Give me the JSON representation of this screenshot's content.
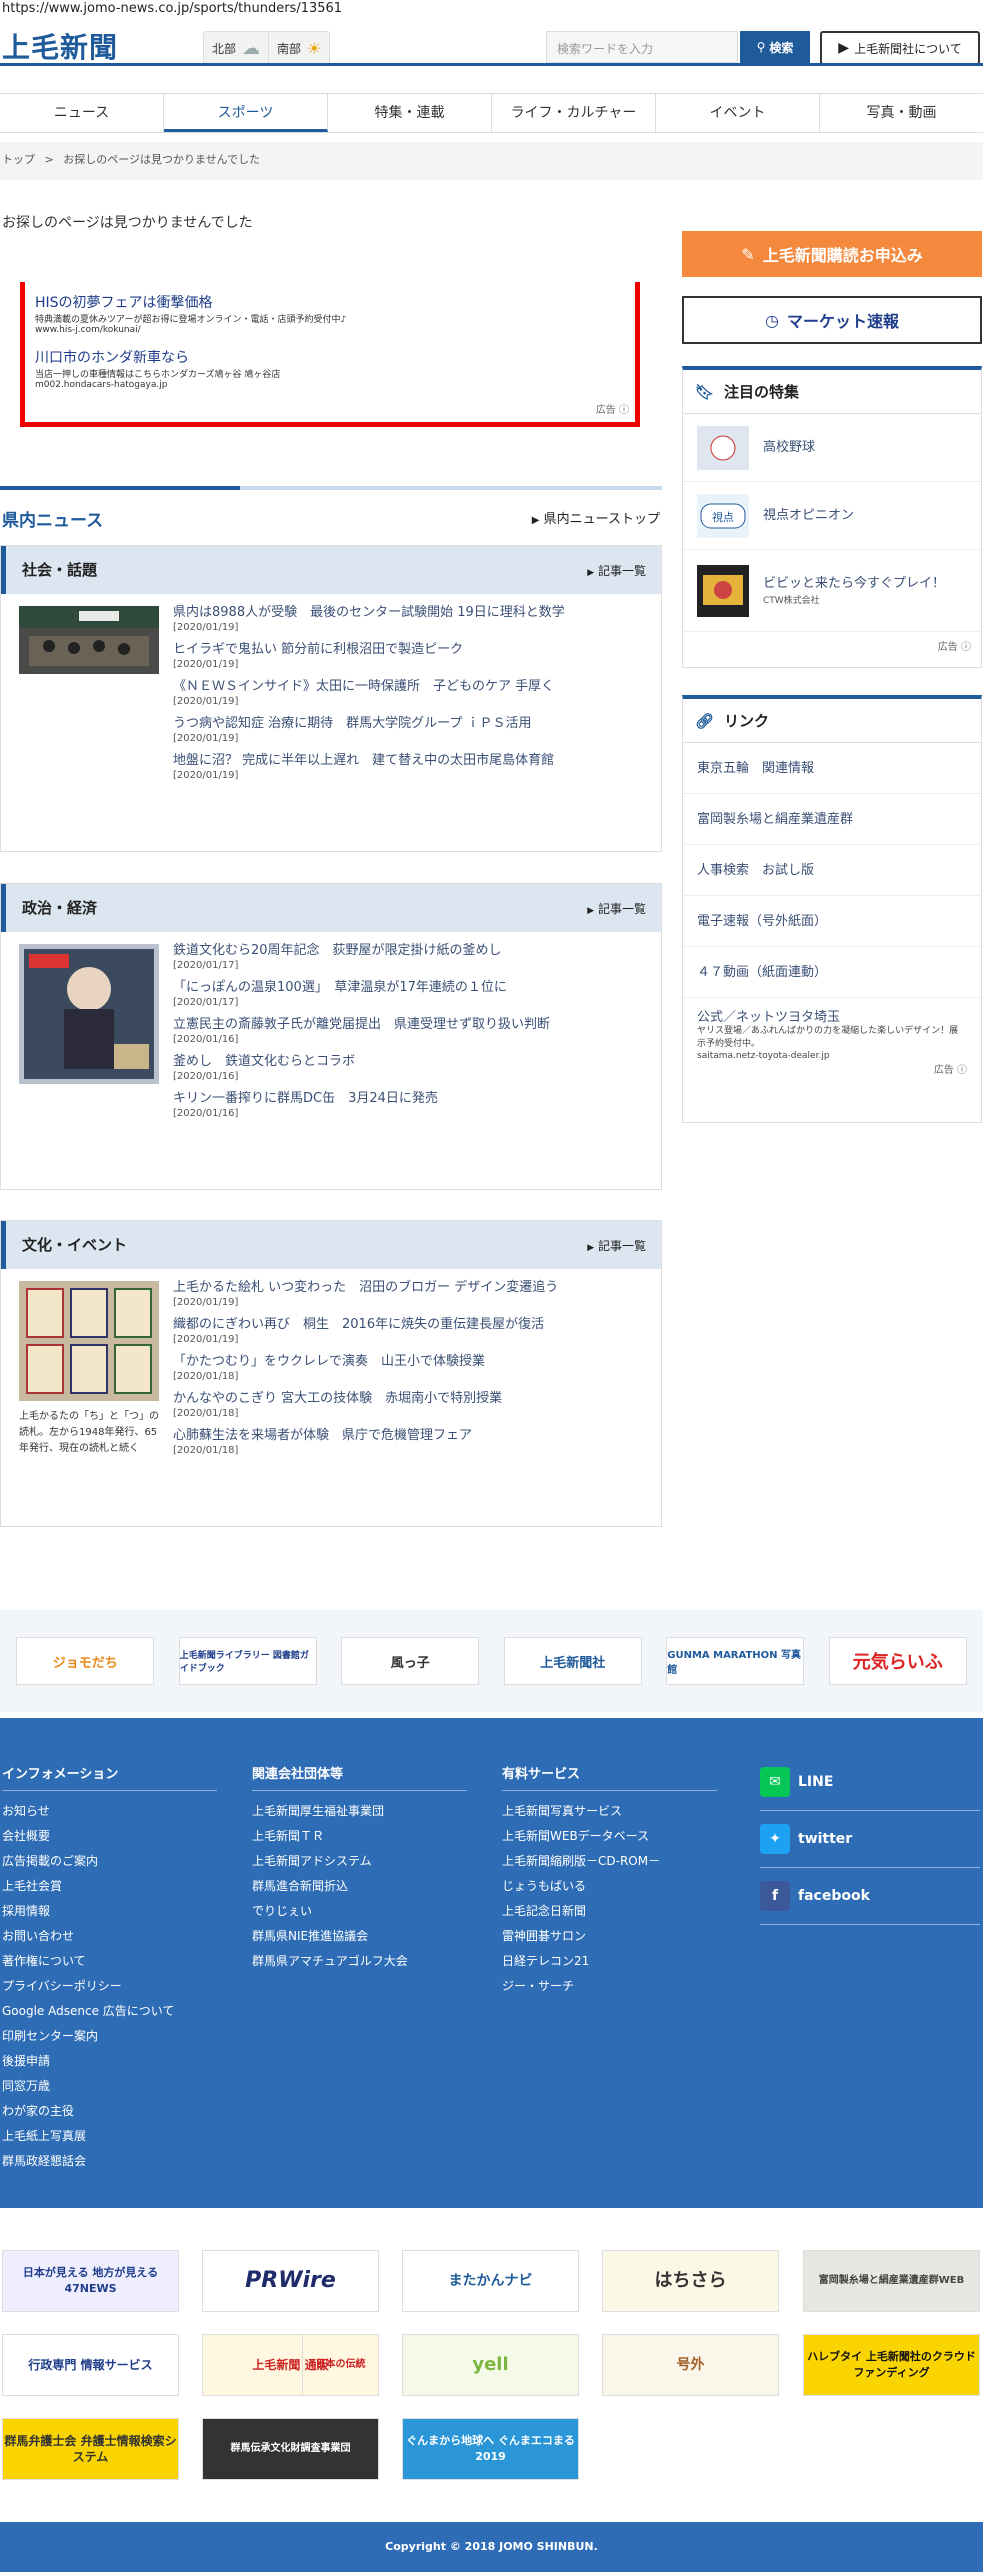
{
  "url": "https://www.jomo-news.co.jp/sports/thunders/13561",
  "header": {
    "logo": "上毛新聞",
    "weather": [
      {
        "label": "北部"
      },
      {
        "label": "南部"
      }
    ],
    "search_placeholder": "検索ワードを入力",
    "search_button": "検索",
    "about_button": "上毛新聞社について"
  },
  "nav": [
    "ニュース",
    "スポーツ",
    "特集・連載",
    "ライフ・カルチャー",
    "イベント",
    "写真・動画"
  ],
  "nav_active": "スポーツ",
  "breadcrumb": {
    "home": "トップ",
    "sep": ">",
    "current": "お探しのページは見つかりませんでした"
  },
  "not_found": "お探しのページは見つかりませんでした",
  "ad": {
    "items": [
      {
        "title": "HISの初夢フェアは衝撃価格",
        "desc": "特典満載の夏休みツアーが超お得に登場オンライン・電話・店頭予約受付中♪",
        "url": "www.his-j.com/kokunai/"
      },
      {
        "title": "川口市のホンダ新車なら",
        "desc": "当店一押しの車種情報はこちらホンダカーズ鳩ヶ谷 鳩ヶ谷店",
        "url": "m002.hondacars-hatogaya.jp"
      }
    ],
    "label": "広告"
  },
  "section": {
    "title": "県内ニュース",
    "link": "県内ニューストップ"
  },
  "boxes": [
    {
      "title": "社会・話題",
      "more": "記事一覧",
      "items": [
        {
          "h": "県内は8988人が受験　最後のセンター試験開始 19日に理科と数学",
          "d": "[2020/01/19]"
        },
        {
          "h": "ヒイラギで鬼払い 節分前に利根沼田で製造ピーク",
          "d": "[2020/01/19]"
        },
        {
          "h": "《ＮＥＷＳインサイド》太田に一時保護所　子どものケア 手厚く",
          "d": "[2020/01/19]"
        },
        {
          "h": "うつ病や認知症 治療に期待　群馬大学院グループ ｉＰＳ活用",
          "d": "[2020/01/19]"
        },
        {
          "h": "地盤に沼？ 完成に半年以上遅れ　建て替え中の太田市尾島体育館",
          "d": "[2020/01/19]"
        }
      ]
    },
    {
      "title": "政治・経済",
      "more": "記事一覧",
      "items": [
        {
          "h": "鉄道文化むら20周年記念　荻野屋が限定掛け紙の釜めし",
          "d": "[2020/01/17]"
        },
        {
          "h": "「にっぽんの温泉100選」　草津温泉が17年連続の１位に",
          "d": "[2020/01/17]"
        },
        {
          "h": "立憲民主の斎藤敦子氏が離党届提出　県連受理せず取り扱い判断",
          "d": "[2020/01/16]"
        },
        {
          "h": "釜めし　鉄道文化むらとコラボ",
          "d": "[2020/01/16]"
        },
        {
          "h": "キリン一番搾りに群馬DC缶　3月24日に発売",
          "d": "[2020/01/16]"
        }
      ]
    },
    {
      "title": "文化・イベント",
      "more": "記事一覧",
      "caption": "上毛かるたの「ち」と「つ」の読札。左から1948年発行、65年発行、現在の読札と続く",
      "items": [
        {
          "h": "上毛かるた絵札 いつ変わった　沼田のブロガー デザイン変遷追う",
          "d": "[2020/01/19]"
        },
        {
          "h": "織都のにぎわい再び　桐生　2016年に焼失の重伝建長屋が復活",
          "d": "[2020/01/19]"
        },
        {
          "h": "「かたつむり」をウクレレで演奏　山王小で体験授業",
          "d": "[2020/01/18]"
        },
        {
          "h": "かんなやのこぎり 宮大工の技体験　赤堀南小で特別授業",
          "d": "[2020/01/18]"
        },
        {
          "h": "心肺蘇生法を来場者が体験　県庁で危機管理フェア",
          "d": "[2020/01/18]"
        }
      ]
    }
  ],
  "right": {
    "subscribe": "上毛新聞購読お申込み",
    "market": "マーケット速報",
    "featured_title": "注目の特集",
    "featured": [
      {
        "t": "高校野球"
      },
      {
        "t": "視点オピニオン"
      },
      {
        "t": "ビビッと来たら今すぐプレイ！",
        "s": "CTW株式会社"
      }
    ],
    "ad_label": "広告",
    "links_title": "リンク",
    "links": [
      "東京五輪　関連情報",
      "富岡製糸場と絹産業遺産群",
      "人事検索　お試し版",
      "電子速報（号外紙面）",
      "４７動画（紙面連動）"
    ],
    "link_ad": {
      "t": "公式／ネットツヨタ埼玉",
      "d": "ヤリス登場／あふれんばかりの力を凝縮した楽しいデザイン！展示予約受付中。",
      "u": "saitama.netz-toyota-dealer.jp"
    }
  },
  "banners1": [
    "ジョモだち",
    "上毛新聞ライブラリー 図書館ガイドブック",
    "風っ子",
    "上毛新聞社",
    "GUNMA MARATHON 写真館",
    "元気らいふ"
  ],
  "footer": {
    "cols": [
      {
        "title": "インフォメーション",
        "items": [
          "お知らせ",
          "会社概要",
          "広告掲載のご案内",
          "上毛社会賞",
          "採用情報",
          "お問い合わせ",
          "著作権について",
          "プライバシーポリシー",
          "Google Adsence 広告について",
          "印刷センター案内",
          "後援申請",
          "同窓万歳",
          "わが家の主役",
          "上毛紙上写真展",
          "群馬政経懇話会"
        ]
      },
      {
        "title": "関連会社団体等",
        "items": [
          "上毛新聞厚生福祉事業団",
          "上毛新聞ＴＲ",
          "上毛新聞アドシステム",
          "群馬進合新聞折込",
          "でりじぇい",
          "群馬県NIE推進協議会",
          "群馬県アマチュアゴルフ大会"
        ]
      },
      {
        "title": "有料サービス",
        "items": [
          "上毛新聞写真サービス",
          "上毛新聞WEBデータベース",
          "上毛新聞縮刷版－CD-ROM－",
          "じょうもばいる",
          "上毛記念日新聞",
          "雷神囲碁サロン",
          "日経テレコン21",
          "ジー・サーチ"
        ]
      }
    ],
    "social": [
      "LINE",
      "twitter",
      "facebook"
    ]
  },
  "banners2": [
    "日本が見える 地方が見える 47NEWS",
    "PRWire",
    "またかんナビ",
    "はちさら",
    "富岡製糸場と絹産業遺産群WEB",
    "行政専門 情報サービス",
    "上毛新聞 通販",
    "日本の伝統",
    "yell",
    "号外",
    "ハレブタイ 上毛新聞社のクラウドファンディング",
    "群馬弁護士会 弁護士情報検索システム",
    "群馬伝承文化財調査事業団",
    "ぐんまから地球へ ぐんまエコまる 2019"
  ],
  "copyright": "Copyright © 2018 JOMO SHINBUN."
}
